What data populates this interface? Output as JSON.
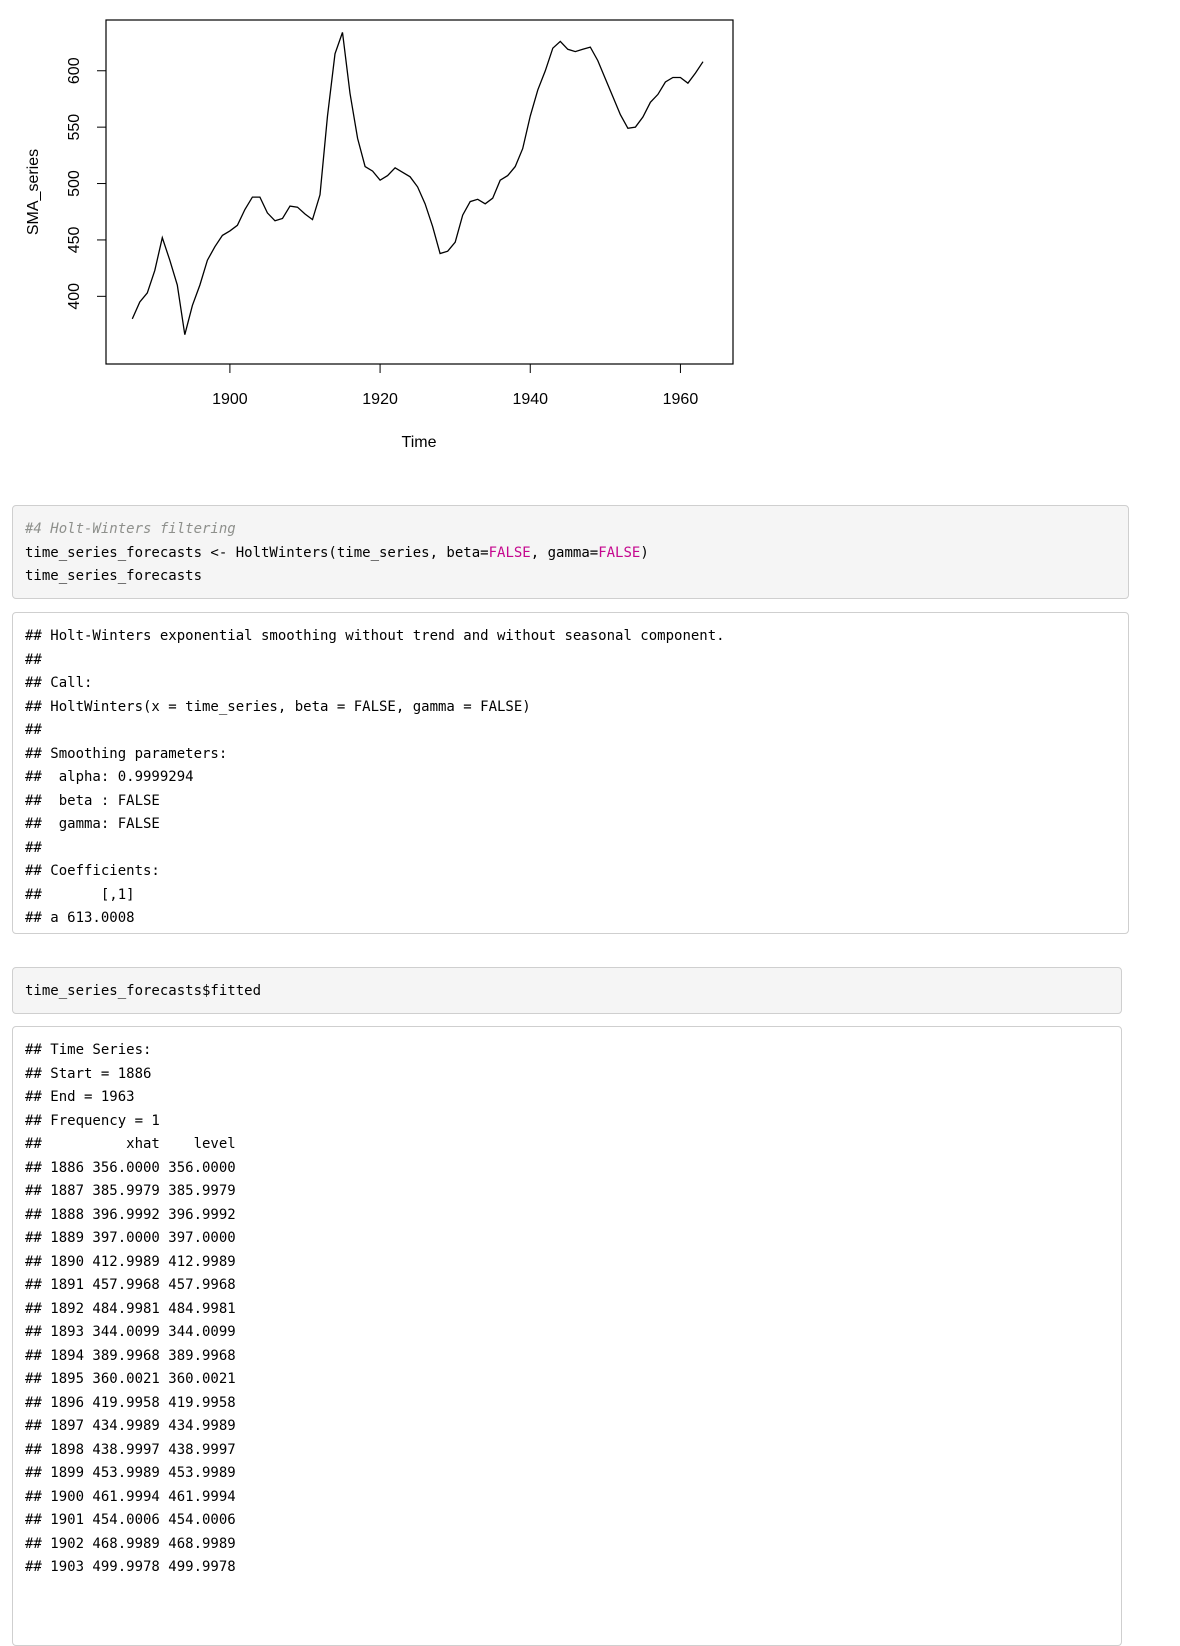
{
  "chart_data": {
    "type": "line",
    "ylabel": "SMA_series",
    "xlabel": "Time",
    "xlim": [
      1883.5,
      1967
    ],
    "ylim": [
      340,
      645
    ],
    "xticks": [
      1900,
      1920,
      1940,
      1960
    ],
    "yticks": [
      400,
      450,
      500,
      550,
      600
    ],
    "grid": false,
    "series": [
      {
        "x": [
          1887,
          1888,
          1889,
          1890,
          1891,
          1892,
          1893,
          1894,
          1895,
          1896,
          1897,
          1898,
          1899,
          1900,
          1901,
          1902,
          1903,
          1904,
          1905,
          1906,
          1907,
          1908,
          1909,
          1910,
          1911,
          1912,
          1913,
          1914,
          1915,
          1916,
          1917,
          1918,
          1919,
          1920,
          1921,
          1922,
          1923,
          1924,
          1925,
          1926,
          1927,
          1928,
          1929,
          1930,
          1931,
          1932,
          1933,
          1934,
          1935,
          1936,
          1937,
          1938,
          1939,
          1940,
          1941,
          1942,
          1943,
          1944,
          1945,
          1946,
          1947,
          1948,
          1949,
          1950,
          1951,
          1952,
          1953,
          1954,
          1955,
          1956,
          1957,
          1958,
          1959,
          1960,
          1961,
          1962,
          1963
        ],
        "values": [
          380,
          395,
          403,
          423,
          452,
          432,
          410,
          366,
          392,
          410,
          432,
          444,
          454,
          458,
          463,
          477,
          488,
          488,
          474,
          467,
          469,
          480,
          479,
          473,
          468,
          490,
          560,
          615,
          634,
          580,
          540,
          515,
          511,
          503,
          507,
          514,
          510,
          506,
          497,
          482,
          462,
          438,
          440,
          448,
          472,
          484,
          486,
          482,
          487,
          503,
          507,
          515,
          531,
          560,
          583,
          600,
          620,
          626,
          619,
          617,
          619,
          621,
          609,
          593,
          577,
          561,
          549,
          550,
          559,
          572,
          579,
          590,
          594,
          594,
          589,
          598,
          608
        ]
      }
    ]
  },
  "chunks": [
    {
      "kind": "code",
      "lines": [
        [
          {
            "t": "#4 Holt-Winters filtering",
            "c": "comment"
          }
        ],
        [
          {
            "t": "time_series_forecasts <- HoltWinters(time_series, beta="
          },
          {
            "t": "FALSE",
            "c": "kw"
          },
          {
            "t": ", gamma="
          },
          {
            "t": "FALSE",
            "c": "kw"
          },
          {
            "t": ")"
          }
        ],
        [
          {
            "t": "time_series_forecasts"
          }
        ]
      ]
    },
    {
      "kind": "output",
      "lines": [
        [
          {
            "t": "## Holt-Winters exponential smoothing without trend and without seasonal component."
          }
        ],
        [
          {
            "t": "##"
          }
        ],
        [
          {
            "t": "## Call:"
          }
        ],
        [
          {
            "t": "## HoltWinters(x = time_series, beta = FALSE, gamma = FALSE)"
          }
        ],
        [
          {
            "t": "##"
          }
        ],
        [
          {
            "t": "## Smoothing parameters:"
          }
        ],
        [
          {
            "t": "##  alpha: 0.9999294"
          }
        ],
        [
          {
            "t": "##  beta : FALSE"
          }
        ],
        [
          {
            "t": "##  gamma: FALSE"
          }
        ],
        [
          {
            "t": "##"
          }
        ],
        [
          {
            "t": "## Coefficients:"
          }
        ],
        [
          {
            "t": "##       [,1]"
          }
        ],
        [
          {
            "t": "## a 613.0008"
          }
        ]
      ]
    },
    {
      "kind": "code",
      "lines": [
        [
          {
            "t": "time_series_forecasts$fitted"
          }
        ]
      ]
    },
    {
      "kind": "output",
      "lines": [
        [
          {
            "t": "## Time Series:"
          }
        ],
        [
          {
            "t": "## Start = 1886"
          }
        ],
        [
          {
            "t": "## End = 1963"
          }
        ],
        [
          {
            "t": "## Frequency = 1"
          }
        ],
        [
          {
            "t": "##          xhat    level"
          }
        ],
        [
          {
            "t": "## 1886 356.0000 356.0000"
          }
        ],
        [
          {
            "t": "## 1887 385.9979 385.9979"
          }
        ],
        [
          {
            "t": "## 1888 396.9992 396.9992"
          }
        ],
        [
          {
            "t": "## 1889 397.0000 397.0000"
          }
        ],
        [
          {
            "t": "## 1890 412.9989 412.9989"
          }
        ],
        [
          {
            "t": "## 1891 457.9968 457.9968"
          }
        ],
        [
          {
            "t": "## 1892 484.9981 484.9981"
          }
        ],
        [
          {
            "t": "## 1893 344.0099 344.0099"
          }
        ],
        [
          {
            "t": "## 1894 389.9968 389.9968"
          }
        ],
        [
          {
            "t": "## 1895 360.0021 360.0021"
          }
        ],
        [
          {
            "t": "## 1896 419.9958 419.9958"
          }
        ],
        [
          {
            "t": "## 1897 434.9989 434.9989"
          }
        ],
        [
          {
            "t": "## 1898 438.9997 438.9997"
          }
        ],
        [
          {
            "t": "## 1899 453.9989 453.9989"
          }
        ],
        [
          {
            "t": "## 1900 461.9994 461.9994"
          }
        ],
        [
          {
            "t": "## 1901 454.0006 454.0006"
          }
        ],
        [
          {
            "t": "## 1902 468.9989 468.9989"
          }
        ],
        [
          {
            "t": "## 1903 499.9978 499.9978"
          }
        ]
      ]
    }
  ]
}
